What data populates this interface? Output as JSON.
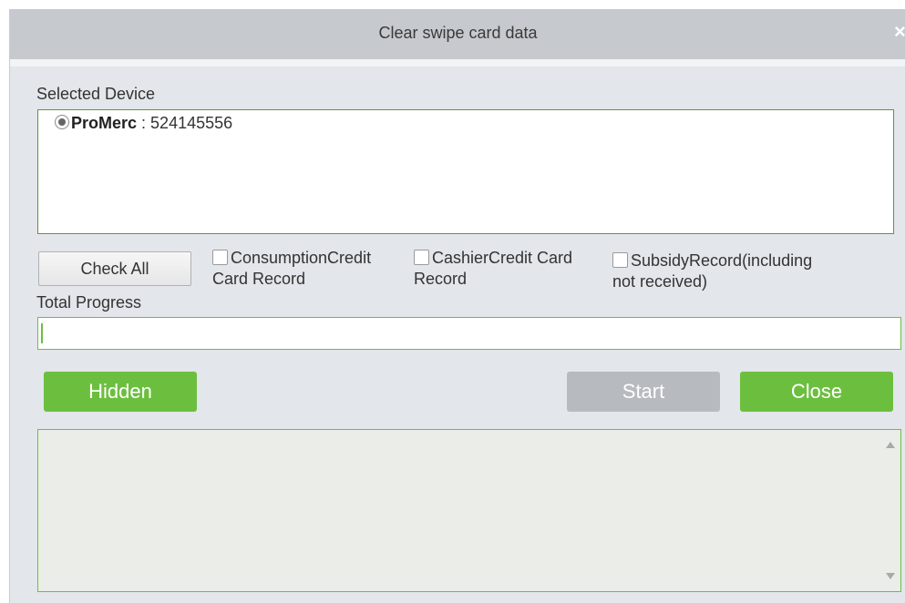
{
  "dialog": {
    "title": "Clear swipe card data",
    "close_glyph": "×"
  },
  "device_section": {
    "label": "Selected Device",
    "device": {
      "name": "ProMerc",
      "separator": " : ",
      "serial": "524145556",
      "selected": true
    }
  },
  "options": {
    "check_all_label": "Check All",
    "items": [
      {
        "line1": "ConsumptionCredit",
        "line2": "Card Record",
        "checked": false
      },
      {
        "line1": "CashierCredit Card",
        "line2": "Record",
        "checked": false
      },
      {
        "line1": "SubsidyRecord(including",
        "line2": "not  received)",
        "checked": false
      }
    ]
  },
  "progress": {
    "label": "Total Progress",
    "value_percent": 0
  },
  "buttons": {
    "hidden_label": "Hidden",
    "start_label": "Start",
    "close_label": "Close"
  },
  "log": {
    "content": ""
  },
  "icons": {
    "close": "close-icon",
    "radio": "radio-selected-icon",
    "scroll_up": "scroll-up-arrow-icon",
    "scroll_down": "scroll-down-arrow-icon"
  },
  "colors": {
    "accent_green": "#6cbf3e",
    "disabled_gray": "#b7bbbf",
    "titlebar": "#c6c9cd"
  }
}
